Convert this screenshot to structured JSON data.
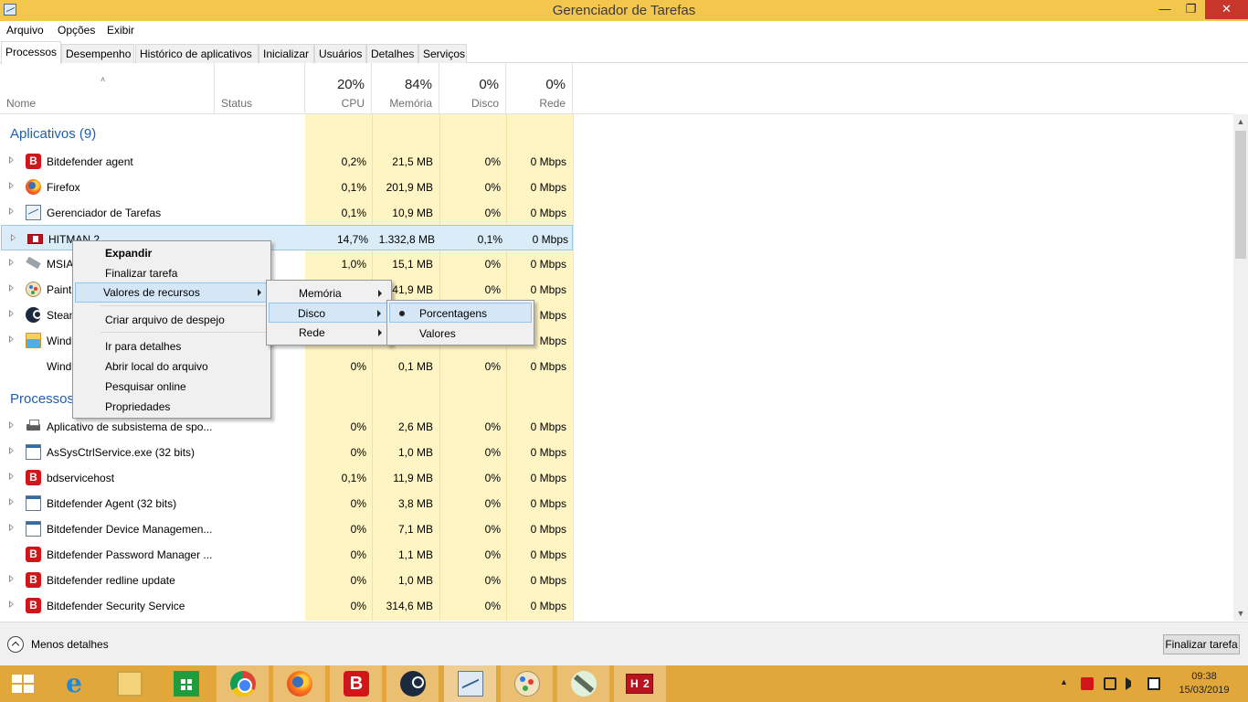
{
  "window": {
    "title": "Gerenciador de Tarefas",
    "min_glyph": "—",
    "max_glyph": "❐",
    "close_glyph": "✕"
  },
  "menu": [
    "Arquivo",
    "Opções",
    "Exibir"
  ],
  "tabs": [
    "Processos",
    "Desempenho",
    "Histórico de aplicativos",
    "Inicializar",
    "Usuários",
    "Detalhes",
    "Serviços"
  ],
  "columns": {
    "name": "Nome",
    "status": "Status",
    "cpu": {
      "pct": "20%",
      "label": "CPU"
    },
    "memory": {
      "pct": "84%",
      "label": "Memória"
    },
    "disk": {
      "pct": "0%",
      "label": "Disco"
    },
    "network": {
      "pct": "0%",
      "label": "Rede"
    }
  },
  "groups": {
    "apps_title": "Aplicativos (9)",
    "processes_title": "Processos em segundo plano"
  },
  "apps": [
    {
      "name": "Bitdefender agent",
      "icon": "bitdefender-icon",
      "cpu": "0,2%",
      "mem": "21,5 MB",
      "disk": "0%",
      "net": "0 Mbps"
    },
    {
      "name": "Firefox",
      "icon": "firefox-icon",
      "cpu": "0,1%",
      "mem": "201,9 MB",
      "disk": "0%",
      "net": "0 Mbps"
    },
    {
      "name": "Gerenciador de Tarefas",
      "icon": "task-manager-icon",
      "cpu": "0,1%",
      "mem": "10,9 MB",
      "disk": "0%",
      "net": "0 Mbps"
    },
    {
      "name": "HITMAN 2",
      "icon": "hitman-icon",
      "cpu": "14,7%",
      "mem": "1.332,8 MB",
      "disk": "0,1%",
      "net": "0 Mbps"
    },
    {
      "name": "MSIA",
      "icon": "msi-icon",
      "cpu": "1,0%",
      "mem": "15,1 MB",
      "disk": "0%",
      "net": "0 Mbps"
    },
    {
      "name": "Paint",
      "icon": "paint-icon",
      "cpu": "",
      "mem": "41,9 MB",
      "disk": "0%",
      "net": "0 Mbps"
    },
    {
      "name": "Stean",
      "icon": "steam-icon",
      "cpu": "",
      "mem": "",
      "disk": "",
      "net": "Mbps"
    },
    {
      "name": "Wind",
      "icon": "folder-icon",
      "cpu": "",
      "mem": "",
      "disk": "",
      "net": "Mbps"
    },
    {
      "name": "Wind",
      "icon": "none",
      "cpu": "0%",
      "mem": "0,1 MB",
      "disk": "0%",
      "net": "0 Mbps"
    }
  ],
  "processes": [
    {
      "name": "Aplicativo de subsistema de spo...",
      "icon": "printer-icon",
      "cpu": "0%",
      "mem": "2,6 MB",
      "disk": "0%",
      "net": "0 Mbps"
    },
    {
      "name": "AsSysCtrlService.exe (32 bits)",
      "icon": "window-icon",
      "cpu": "0%",
      "mem": "1,0 MB",
      "disk": "0%",
      "net": "0 Mbps"
    },
    {
      "name": "bdservicehost",
      "icon": "bitdefender-icon",
      "cpu": "0,1%",
      "mem": "11,9 MB",
      "disk": "0%",
      "net": "0 Mbps"
    },
    {
      "name": "Bitdefender Agent (32 bits)",
      "icon": "window-icon",
      "cpu": "0%",
      "mem": "3,8 MB",
      "disk": "0%",
      "net": "0 Mbps"
    },
    {
      "name": "Bitdefender Device Managemen...",
      "icon": "window-icon",
      "cpu": "0%",
      "mem": "7,1 MB",
      "disk": "0%",
      "net": "0 Mbps"
    },
    {
      "name": "Bitdefender Password Manager ...",
      "icon": "bitdefender-icon",
      "cpu": "0%",
      "mem": "1,1 MB",
      "disk": "0%",
      "net": "0 Mbps"
    },
    {
      "name": "Bitdefender redline update",
      "icon": "bitdefender-icon",
      "cpu": "0%",
      "mem": "1,0 MB",
      "disk": "0%",
      "net": "0 Mbps"
    },
    {
      "name": "Bitdefender Security Service",
      "icon": "bitdefender-icon",
      "cpu": "0%",
      "mem": "314,6 MB",
      "disk": "0%",
      "net": "0 Mbps"
    }
  ],
  "context_menu": {
    "items": [
      "Expandir",
      "Finalizar tarefa",
      "Valores de recursos",
      "Criar arquivo de despejo",
      "Ir para detalhes",
      "Abrir local do arquivo",
      "Pesquisar online",
      "Propriedades"
    ]
  },
  "resource_submenu": {
    "items": [
      "Memória",
      "Disco",
      "Rede"
    ]
  },
  "disk_submenu": {
    "items": [
      "Porcentagens",
      "Valores"
    ]
  },
  "footer": {
    "less_details": "Menos detalhes",
    "end_task": "Finalizar tarefa"
  },
  "taskbar": {
    "apps": [
      "start-icon",
      "internet-explorer-icon",
      "file-explorer-icon",
      "store-icon",
      "chrome-icon",
      "firefox-icon",
      "bitdefender-icon",
      "steam-icon",
      "task-manager-icon",
      "paint-icon",
      "msi-afterburner-icon",
      "hitman-2-icon"
    ],
    "ie_glyph": "e",
    "bd_glyph": "B",
    "hitman_h": "H",
    "hitman_2": "2",
    "clock_time": "09:38",
    "clock_date": "15/03/2019",
    "tray_chevron": "▲"
  },
  "scroll": {
    "up": "▲",
    "down": "▼"
  },
  "sort_glyph": "˄",
  "colors": {
    "titlebar": "#f3c74e",
    "taskbar": "#e2a73b",
    "heat": "#fff4c4",
    "group_title": "#1f5fae"
  }
}
